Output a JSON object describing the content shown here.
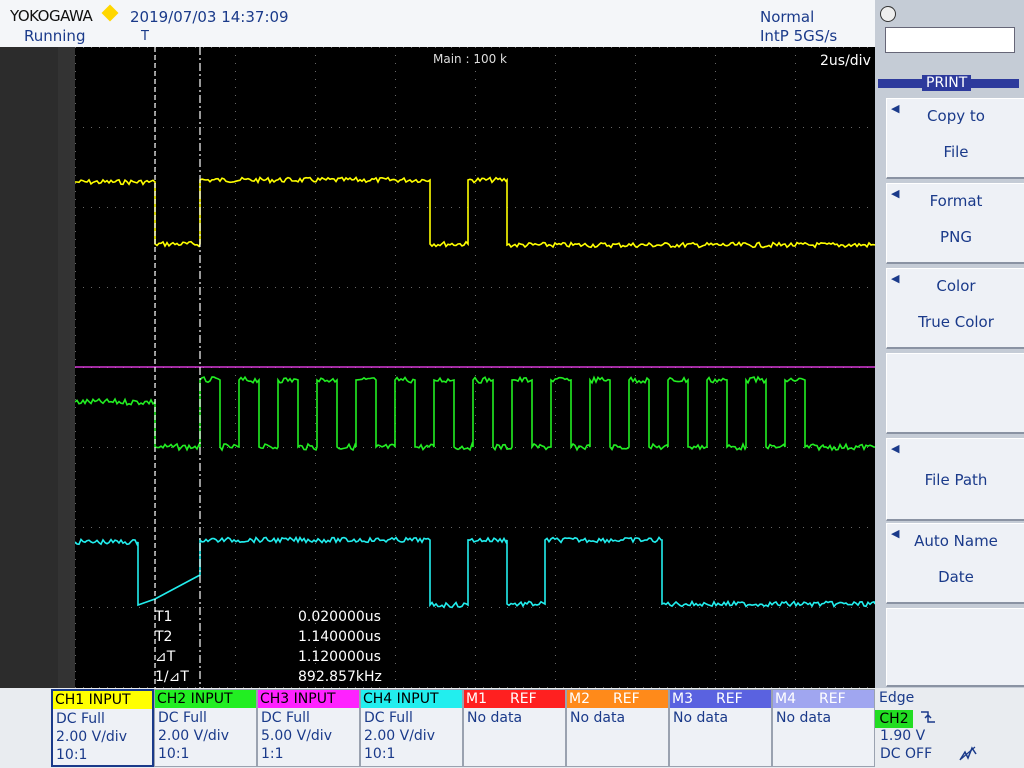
{
  "header": {
    "brand": "YOKOGAWA",
    "datetime": "2019/07/03 14:37:09",
    "status": "Running",
    "trigger_mark": "T",
    "trigger_mode": "Normal",
    "acquisition": "IntP  5GS/s"
  },
  "screen": {
    "main_label": "Main : 100 k",
    "time_div": "2us/div"
  },
  "cursors": [
    {
      "label": "T1",
      "value": "0.020000us"
    },
    {
      "label": "T2",
      "value": "1.140000us"
    },
    {
      "label": "⊿T",
      "value": "1.120000us"
    },
    {
      "label": "1/⊿T",
      "value": "892.857kHz"
    }
  ],
  "menu": {
    "title": "PRINT",
    "items": [
      {
        "line1": "Copy to",
        "line2": "File"
      },
      {
        "line1": "Format",
        "line2": "PNG"
      },
      {
        "line1": "Color",
        "line2": "True Color"
      },
      {
        "line1": "",
        "line2": ""
      },
      {
        "line1": "File Path",
        "line2": ""
      },
      {
        "line1": "Auto Name",
        "line2": "Date"
      },
      {
        "line1": "",
        "line2": ""
      }
    ]
  },
  "channels": [
    {
      "title": "CH1 INPUT",
      "coupling": "DC Full",
      "scale": "2.00 V/div",
      "probe": "10:1",
      "color": "#ffff00"
    },
    {
      "title": "CH2 INPUT",
      "coupling": "DC Full",
      "scale": "2.00 V/div",
      "probe": "10:1",
      "color": "#22ee22"
    },
    {
      "title": "CH3 INPUT",
      "coupling": "DC Full",
      "scale": "5.00 V/div",
      "probe": "1:1",
      "color": "#ff22ff"
    },
    {
      "title": "CH4 INPUT",
      "coupling": "DC Full",
      "scale": "2.00 V/div",
      "probe": "10:1",
      "color": "#22eeee"
    },
    {
      "title": "M1",
      "tag": "REF",
      "status": "No data",
      "color": "#ff2020"
    },
    {
      "title": "M2",
      "tag": "REF",
      "status": "No data",
      "color": "#ff8a1a"
    },
    {
      "title": "M3",
      "tag": "REF",
      "status": "No data",
      "color": "#5a62e0"
    },
    {
      "title": "M4",
      "tag": "REF",
      "status": "No data",
      "color": "#a0a6f0"
    }
  ],
  "trigger": {
    "type": "Edge",
    "source": "CH2",
    "level": "1.90 V",
    "coupling": "DC OFF"
  },
  "trace_colors": {
    "ch1": "#ffff00",
    "ch2": "#22ee22",
    "ch3": "#ff44ff",
    "ch4": "#22eeee"
  }
}
